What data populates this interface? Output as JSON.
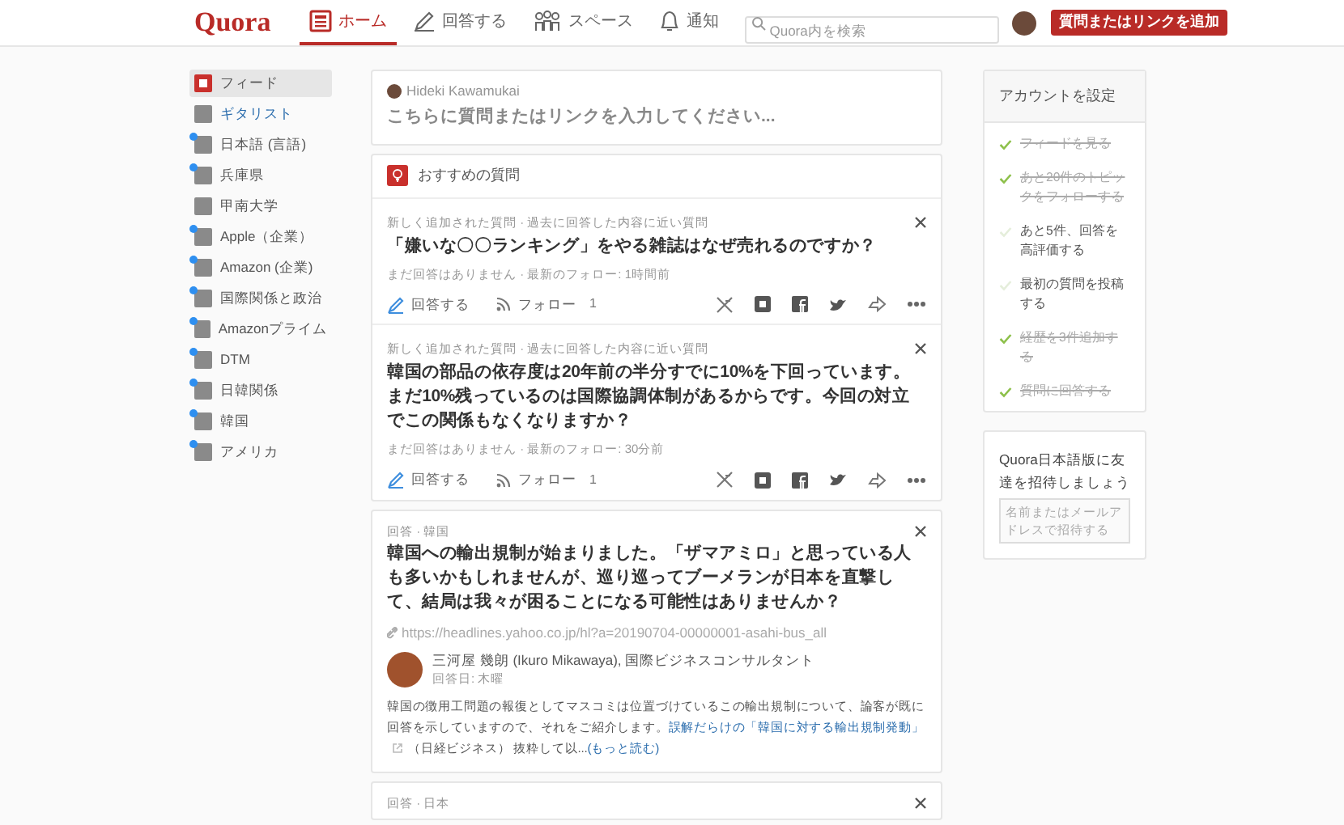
{
  "header": {
    "logo": "Quora",
    "nav": [
      {
        "label": "ホーム",
        "selected": true,
        "kind": "home"
      },
      {
        "label": "回答する",
        "selected": false,
        "kind": "answer"
      },
      {
        "label": "スペース",
        "selected": false,
        "kind": "spaces"
      },
      {
        "label": "通知",
        "selected": false,
        "kind": "bell"
      }
    ],
    "search": {
      "placeholder": "Quora内を検索"
    },
    "add_button": "質問またはリンクを追加"
  },
  "sidebar": {
    "items": [
      {
        "label": "フィード",
        "selected": true,
        "highlighted": false,
        "has_update": false,
        "kind": "feed"
      },
      {
        "label": "ギタリスト",
        "selected": false,
        "highlighted": true,
        "has_update": false,
        "kind": "topic"
      },
      {
        "label": "日本語 (言語)",
        "selected": false,
        "highlighted": false,
        "has_update": true,
        "kind": "topic"
      },
      {
        "label": "兵庫県",
        "selected": false,
        "highlighted": false,
        "has_update": true,
        "kind": "topic"
      },
      {
        "label": "甲南大学",
        "selected": false,
        "highlighted": false,
        "has_update": false,
        "kind": "topic"
      },
      {
        "label": "Apple（企業）",
        "selected": false,
        "highlighted": false,
        "has_update": true,
        "kind": "topic"
      },
      {
        "label": "Amazon (企業)",
        "selected": false,
        "highlighted": false,
        "has_update": true,
        "kind": "topic"
      },
      {
        "label": "国際関係と政治",
        "selected": false,
        "highlighted": false,
        "has_update": true,
        "kind": "topic"
      },
      {
        "label": "Amazonプライム",
        "selected": false,
        "highlighted": false,
        "has_update": true,
        "kind": "topic"
      },
      {
        "label": "DTM",
        "selected": false,
        "highlighted": false,
        "has_update": true,
        "kind": "topic"
      },
      {
        "label": "日韓関係",
        "selected": false,
        "highlighted": false,
        "has_update": true,
        "kind": "topic"
      },
      {
        "label": "韓国",
        "selected": false,
        "highlighted": false,
        "has_update": true,
        "kind": "topic"
      },
      {
        "label": "アメリカ",
        "selected": false,
        "highlighted": false,
        "has_update": true,
        "kind": "topic"
      }
    ]
  },
  "ask_box": {
    "user": "Hideki Kawamukai",
    "placeholder": "こちらに質問またはリンクを入力してください..."
  },
  "recommended": {
    "title": "おすすめの質問",
    "questions": [
      {
        "meta": "新しく追加された質問 · 過去に回答した内容に近い質問",
        "title": "「嫌いな〇〇ランキング」をやる雑誌はなぜ売れるのですか？",
        "status": "まだ回答はありません · 最新のフォロー: 1時間前",
        "answer_label": "回答する",
        "follow_label": "フォロー",
        "follow_count": "1"
      },
      {
        "meta": "新しく追加された質問 · 過去に回答した内容に近い質問",
        "title": "韓国の部品の依存度は20年前の半分すでに10%を下回っています。まだ10%残っているのは国際協調体制があるからです。今回の対立でこの関係もなくなりますか？",
        "status": "まだ回答はありません · 最新のフォロー: 30分前",
        "answer_label": "回答する",
        "follow_label": "フォロー",
        "follow_count": "1"
      }
    ]
  },
  "answer_card": {
    "meta": "回答 · 韓国",
    "title": "韓国への輸出規制が始まりました。「ザマアミロ」と思っている人も多いかもしれませんが、巡り巡ってブーメランが日本を直撃して、結局は我々が困ることになる可能性はありませんか？",
    "url": "https://headlines.yahoo.co.jp/hl?a=20190704-00000001-asahi-bus_all",
    "author": "三河屋 幾朗 (Ikuro Mikawaya), 国際ビジネスコンサルタント",
    "date": "回答日: 木曜",
    "body": "韓国の徴用工問題の報復としてマスコミは位置づけているこの輸出規制について、論客が既に回答を示していますので、それをご紹介します。",
    "body_link": "誤解だらけの「韓国に対する輸出規制発動」",
    "body_after": "（日経ビジネス） 抜粋して以...",
    "more_link": "(もっと読む)"
  },
  "next_card": {
    "meta": "回答 · 日本"
  },
  "account_setup": {
    "title": "アカウントを設定",
    "tasks": [
      {
        "label": "フィードを見る",
        "done": true
      },
      {
        "label": "あと20件のトピックをフォローする",
        "done": true
      },
      {
        "label": "あと5件、回答を高評価する",
        "done": false
      },
      {
        "label": "最初の質問を投稿する",
        "done": false
      },
      {
        "label": "経歴を3件追加する",
        "done": true
      },
      {
        "label": "質問に回答する",
        "done": true
      }
    ]
  },
  "invite": {
    "title": "Quora日本語版に友達を招待しましょう",
    "placeholder": "名前またはメールアドレスで招待する"
  }
}
